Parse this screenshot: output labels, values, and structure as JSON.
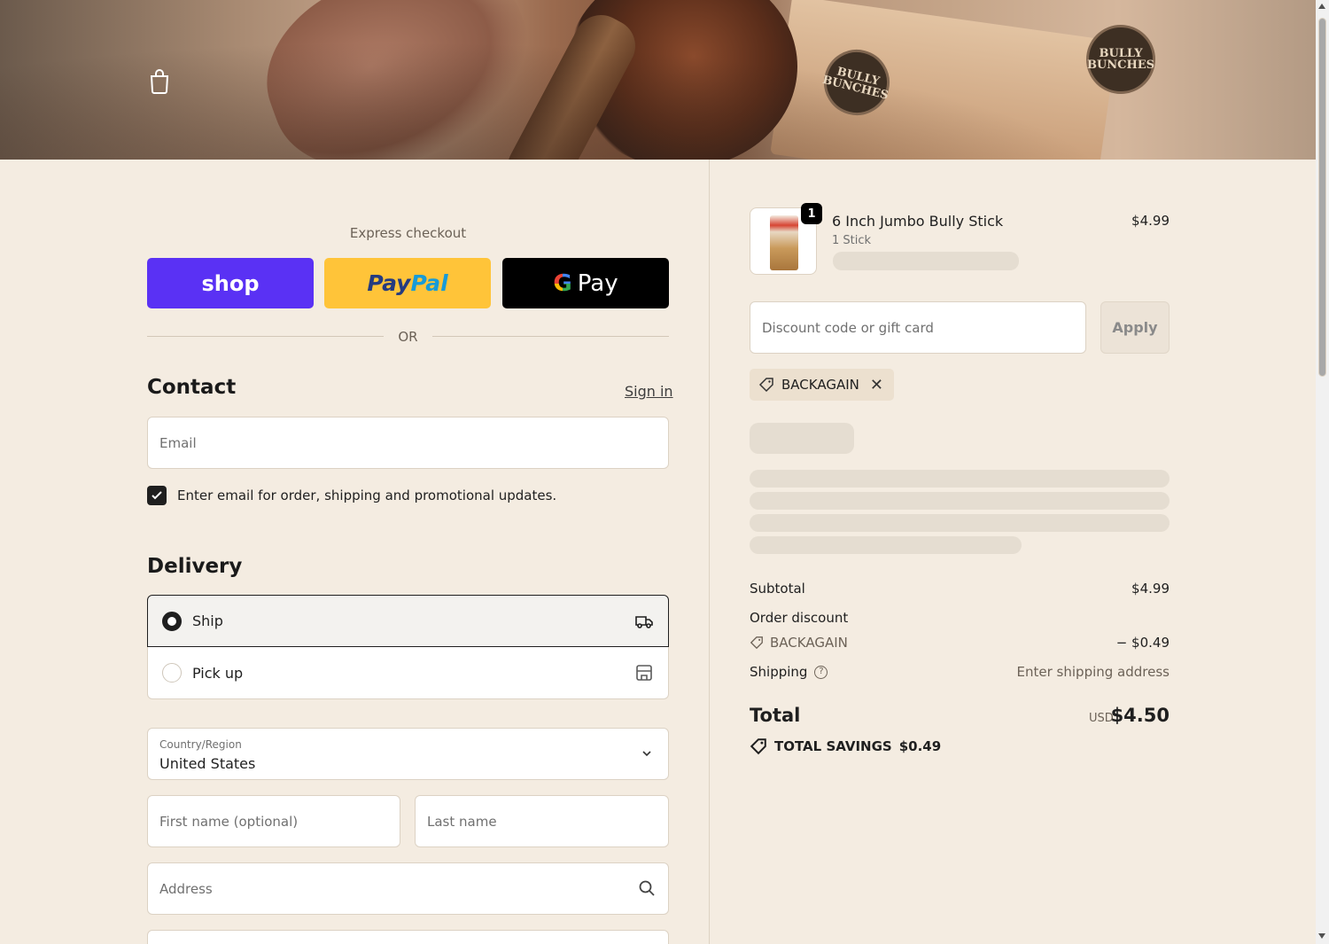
{
  "header": {
    "brand_badge_text": "BULLY BUNCHES",
    "cart_icon": "shopping-bag-icon"
  },
  "express": {
    "label": "Express checkout",
    "shop_label": "shop",
    "paypal_label_1": "Pay",
    "paypal_label_2": "Pal",
    "gpay_label_g": "G",
    "gpay_label": "Pay",
    "or_label": "OR"
  },
  "contact": {
    "title": "Contact",
    "signin": "Sign in",
    "email_placeholder": "Email",
    "marketing_label": "Enter email for order, shipping and promotional updates.",
    "marketing_checked": true
  },
  "delivery": {
    "title": "Delivery",
    "options": [
      {
        "label": "Ship",
        "selected": true,
        "icon": "truck-icon"
      },
      {
        "label": "Pick up",
        "selected": false,
        "icon": "store-icon"
      }
    ],
    "country_label": "Country/Region",
    "country_value": "United States",
    "first_name_placeholder": "First name (optional)",
    "last_name_placeholder": "Last name",
    "address_placeholder": "Address"
  },
  "order": {
    "item": {
      "name": "6 Inch Jumbo Bully Stick",
      "variant": "1 Stick",
      "price": "$4.99",
      "quantity": "1"
    },
    "discount_placeholder": "Discount code or gift card",
    "apply_label": "Apply",
    "applied_code": "BACKAGAIN",
    "remove_icon": "close-icon",
    "subtotal_label": "Subtotal",
    "subtotal_value": "$4.99",
    "order_discount_label": "Order discount",
    "discount_code": "BACKAGAIN",
    "discount_value": "− $0.49",
    "shipping_label": "Shipping",
    "shipping_value": "Enter shipping address",
    "total_label": "Total",
    "currency": "USD",
    "total_value": "$4.50",
    "savings_label": "TOTAL SAVINGS",
    "savings_value": "$0.49"
  },
  "colors": {
    "background": "#f4ece1",
    "shop_pay": "#5a31f4",
    "paypal": "#ffc439",
    "gpay": "#000000"
  }
}
